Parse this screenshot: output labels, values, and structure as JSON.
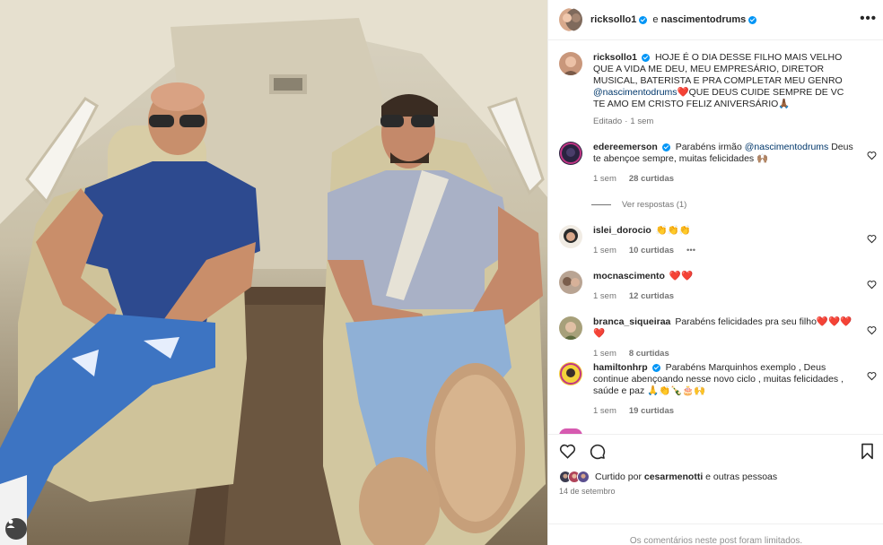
{
  "post": {
    "author": "ricksollo1",
    "conjunction": "e",
    "coauthor": "nascimentodrums",
    "more_label": "•••"
  },
  "caption": {
    "username": "ricksollo1",
    "text_before": "HOJE É O DIA DESSE FILHO MAIS VELHO QUE A VIDA ME DEU, MEU EMPRESÁRIO, DIRETOR MUSICAL, BATERISTA E PRA COMPLETAR MEU GENRO",
    "mention": "@nascimentodrums",
    "text_after": "❤️QUE DEUS CUIDE SEMPRE DE VC TE AMO EM CRISTO FELIZ ANIVERSÁRIO🙏🏾",
    "edited": "Editado",
    "time": "1 sem"
  },
  "comments": [
    {
      "username": "edereemerson",
      "verified": true,
      "text_before": "Parabéns irmão",
      "mention": "@nascimentodrums",
      "text_after": "Deus te abençoe sempre, muitas felicidades 🙌🏽",
      "time": "1 sem",
      "likes": "28 curtidas",
      "replies": "Ver respostas (1)"
    },
    {
      "username": "islei_dorocio",
      "text": "👏👏👏",
      "time": "1 sem",
      "likes": "10 curtidas",
      "extra": "•••"
    },
    {
      "username": "mocnascimento",
      "text": "❤️❤️",
      "time": "1 sem",
      "likes": "12 curtidas"
    },
    {
      "username": "branca_siqueiraa",
      "text": "Parabéns felicidades pra seu filho❤️❤️❤️❤️",
      "time": "1 sem",
      "likes": "8 curtidas"
    },
    {
      "username": "hamiltonhrp",
      "verified": true,
      "text": "Parabéns Marquinhos exemplo , Deus continue abençoando nesse novo ciclo , muitas felicidades , saúde e paz 🙏👏🍾🎂🙌",
      "time": "1 sem",
      "likes": "19 curtidas"
    }
  ],
  "actions": {
    "liked_by_prefix": "Curtido por",
    "liked_by_user": "cesarmenotti",
    "liked_by_suffix": "e outras pessoas",
    "date": "14 de setembro",
    "comments_limited": "Os comentários neste post foram limitados."
  },
  "icons": {
    "like": "heart-icon",
    "comment": "comment-icon",
    "save": "bookmark-icon",
    "tag": "user-tag-icon"
  },
  "colors": {
    "verified": "#0095f6",
    "link": "#00376b",
    "secondary_text": "#737373",
    "border": "#efefef"
  }
}
